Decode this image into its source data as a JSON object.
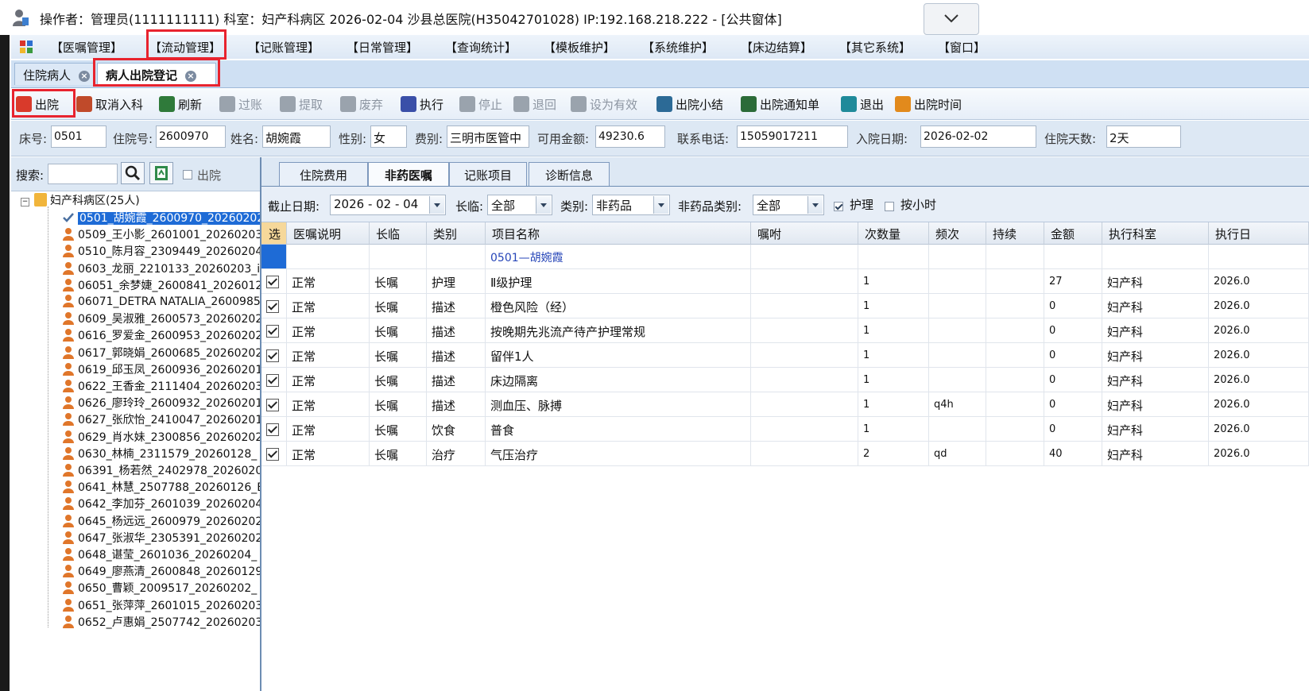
{
  "titlebar": {
    "text": "操作者：管理员(1111111111)  科室：妇产科病区  2026-02-04  沙县总医院(H35042701028) IP:192.168.218.222 - [公共窗体]"
  },
  "menu": [
    "【医嘱管理】",
    "【流动管理】",
    "【记账管理】",
    "【日常管理】",
    "【查询统计】",
    "【模板维护】",
    "【系统维护】",
    "【床边结算】",
    "【其它系统】",
    "【窗口】"
  ],
  "doc_tabs": [
    {
      "label": "住院病人"
    },
    {
      "label": "病人出院登记"
    }
  ],
  "toolbar": [
    {
      "label": "出院",
      "icon": "discharge-icon",
      "color": "#d93a2b",
      "enabled": true
    },
    {
      "label": "取消入科",
      "icon": "cancel-admit-icon",
      "color": "#c04a2a",
      "enabled": true
    },
    {
      "label": "刷新",
      "icon": "refresh-icon",
      "color": "#2f7a3a",
      "enabled": true
    },
    {
      "label": "过账",
      "icon": "post-icon",
      "color": "#9aa3ad",
      "enabled": false
    },
    {
      "label": "提取",
      "icon": "extract-icon",
      "color": "#9aa3ad",
      "enabled": false
    },
    {
      "label": "废弃",
      "icon": "trash-icon",
      "color": "#9aa3ad",
      "enabled": false
    },
    {
      "label": "执行",
      "icon": "execute-icon",
      "color": "#3a4fa8",
      "enabled": true
    },
    {
      "label": "停止",
      "icon": "stop-icon",
      "color": "#9aa3ad",
      "enabled": false
    },
    {
      "label": "退回",
      "icon": "return-icon",
      "color": "#9aa3ad",
      "enabled": false
    },
    {
      "label": "设为有效",
      "icon": "set-valid-icon",
      "color": "#9aa3ad",
      "enabled": false
    },
    {
      "label": "出院小结",
      "icon": "summary-icon",
      "color": "#2c6a96",
      "enabled": true
    },
    {
      "label": "出院通知单",
      "icon": "notice-icon",
      "color": "#2b6b38",
      "enabled": true
    },
    {
      "label": "退出",
      "icon": "exit-icon",
      "color": "#1f8a9a",
      "enabled": true
    },
    {
      "label": "出院时间",
      "icon": "time-icon",
      "color": "#e28a1c",
      "enabled": true
    }
  ],
  "patient": {
    "bed_label": "床号:",
    "bed": "0501",
    "inpatient_no_label": "住院号:",
    "inpatient_no": "2600970",
    "name_label": "姓名:",
    "name": "胡婉霞",
    "sex_label": "性别:",
    "sex": "女",
    "fee_type_label": "费别:",
    "fee_type": "三明市医管中",
    "balance_label": "可用金额:",
    "balance": "49230.6",
    "phone_label": "联系电话:",
    "phone": "15059017211",
    "admit_date_label": "入院日期:",
    "admit_date": "2026-02-02",
    "days_label": "住院天数:",
    "days": "2天"
  },
  "search": {
    "label": "搜索:",
    "value": "",
    "discharged_label": "出院"
  },
  "tree": {
    "root": "妇产科病区(25人)",
    "items": [
      "0501_胡婉霞_2600970_20260202",
      "0509_王小影_2601001_20260203",
      "0510_陈月容_2309449_20260204",
      "0603_龙丽_2210133_20260203_i",
      "06051_余梦婕_2600841_2026012",
      "06071_DETRA NATALIA_2600985_",
      "0609_吴淑雅_2600573_20260202",
      "0616_罗爱金_2600953_20260202",
      "0617_郭晓娟_2600685_20260202",
      "0619_邱玉凤_2600936_20260201",
      "0622_王香金_2111404_20260203",
      "0626_廖玲玲_2600932_20260201",
      "0627_张欣怡_2410047_20260201",
      "0629_肖水妹_2300856_20260202",
      "0630_林楠_2311579_20260128_",
      "06391_杨若然_2402978_2026020",
      "0641_林慧_2507788_20260126_E",
      "0642_李加芬_2601039_20260204",
      "0645_杨远远_2600979_20260202",
      "0647_张淑华_2305391_20260202",
      "0648_谌莹_2601036_20260204_",
      "0649_廖燕清_2600848_20260129",
      "0650_曹颖_2009517_20260202_",
      "0651_张萍萍_2601015_20260203",
      "0652_卢惠娟_2507742_20260203"
    ]
  },
  "subtabs": [
    "住院费用",
    "非药医嘱",
    "记账项目",
    "诊断信息"
  ],
  "filters": {
    "end_date_label": "截止日期:",
    "end_date": "2026 - 02 - 04",
    "long_label": "长临:",
    "long_value": "全部",
    "category_label": "类别:",
    "category_value": "非药品",
    "nondrug_label": "非药品类别:",
    "nondrug_value": "全部",
    "nursing_label": "护理",
    "hourly_label": "按小时"
  },
  "grid": {
    "headers": [
      "选",
      "医嘱说明",
      "长临",
      "类别",
      "项目名称",
      "嘱咐",
      "次数量",
      "频次",
      "持续",
      "金额",
      "执行科室",
      "执行日"
    ],
    "group_row": "0501—胡婉霞",
    "rows": [
      {
        "note": "正常",
        "long": "长嘱",
        "cat": "护理",
        "item": "Ⅱ级护理",
        "advice": "",
        "qty": "1",
        "freq": "",
        "dur": "",
        "amount": "27",
        "dept": "妇产科",
        "date": "2026.0"
      },
      {
        "note": "正常",
        "long": "长嘱",
        "cat": "描述",
        "item": "橙色风险（经）",
        "advice": "",
        "qty": "1",
        "freq": "",
        "dur": "",
        "amount": "0",
        "dept": "妇产科",
        "date": "2026.0"
      },
      {
        "note": "正常",
        "long": "长嘱",
        "cat": "描述",
        "item": "按晚期先兆流产待产护理常规",
        "advice": "",
        "qty": "1",
        "freq": "",
        "dur": "",
        "amount": "0",
        "dept": "妇产科",
        "date": "2026.0"
      },
      {
        "note": "正常",
        "long": "长嘱",
        "cat": "描述",
        "item": "留伴1人",
        "advice": "",
        "qty": "1",
        "freq": "",
        "dur": "",
        "amount": "0",
        "dept": "妇产科",
        "date": "2026.0"
      },
      {
        "note": "正常",
        "long": "长嘱",
        "cat": "描述",
        "item": "床边隔离",
        "advice": "",
        "qty": "1",
        "freq": "",
        "dur": "",
        "amount": "0",
        "dept": "妇产科",
        "date": "2026.0"
      },
      {
        "note": "正常",
        "long": "长嘱",
        "cat": "描述",
        "item": "测血压、脉搏",
        "advice": "",
        "qty": "1",
        "freq": "q4h",
        "dur": "",
        "amount": "0",
        "dept": "妇产科",
        "date": "2026.0"
      },
      {
        "note": "正常",
        "long": "长嘱",
        "cat": "饮食",
        "item": "普食",
        "advice": "",
        "qty": "1",
        "freq": "",
        "dur": "",
        "amount": "0",
        "dept": "妇产科",
        "date": "2026.0"
      },
      {
        "note": "正常",
        "long": "长嘱",
        "cat": "治疗",
        "item": "气压治疗",
        "advice": "",
        "qty": "2",
        "freq": "qd",
        "dur": "",
        "amount": "40",
        "dept": "妇产科",
        "date": "2026.0"
      }
    ]
  }
}
